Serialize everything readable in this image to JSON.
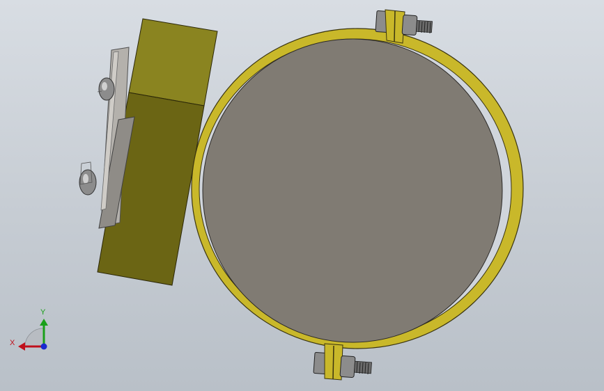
{
  "viewport": {
    "background_top": "#d8dde3",
    "background_bottom": "#b9c0c8"
  },
  "model": {
    "clamp_band_color": "#c9b82a",
    "clamp_band_edge": "#3a3410",
    "cylinder_color": "#807b73",
    "cylinder_edge": "#2a2826",
    "mount_block_top_color": "#8a8420",
    "mount_block_side_color": "#6b6514",
    "plate_color": "#a9a6a1",
    "plate_edge": "#505050",
    "bolt_color": "#8c8c8c",
    "thread_color": "#4a4a4a"
  },
  "triad": {
    "x_label": "X",
    "y_label": "Y",
    "x_color": "#c0101c",
    "y_color": "#1aa01a",
    "z_color": "#1a2ad0"
  }
}
